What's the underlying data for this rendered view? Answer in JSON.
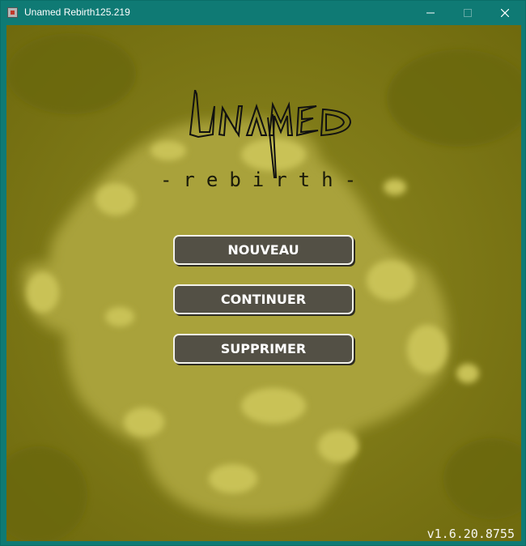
{
  "window": {
    "title": "Unamed Rebirth125.219",
    "icon": "app-icon",
    "controls": {
      "minimize": "minimize-icon",
      "maximize": "maximize-icon",
      "close": "close-icon"
    }
  },
  "game": {
    "logo_text": "UNAMED",
    "subtitle": "-rebirth-",
    "menu": {
      "new_label": "NOUVEAU",
      "continue_label": "CONTINUER",
      "delete_label": "SUPPRIMER"
    },
    "version": "v1.6.20.8755"
  },
  "colors": {
    "titlebar": "#0f7a74",
    "background": "#7f7a14",
    "button_fill": "#535045",
    "button_border": "#f2f2ea"
  }
}
